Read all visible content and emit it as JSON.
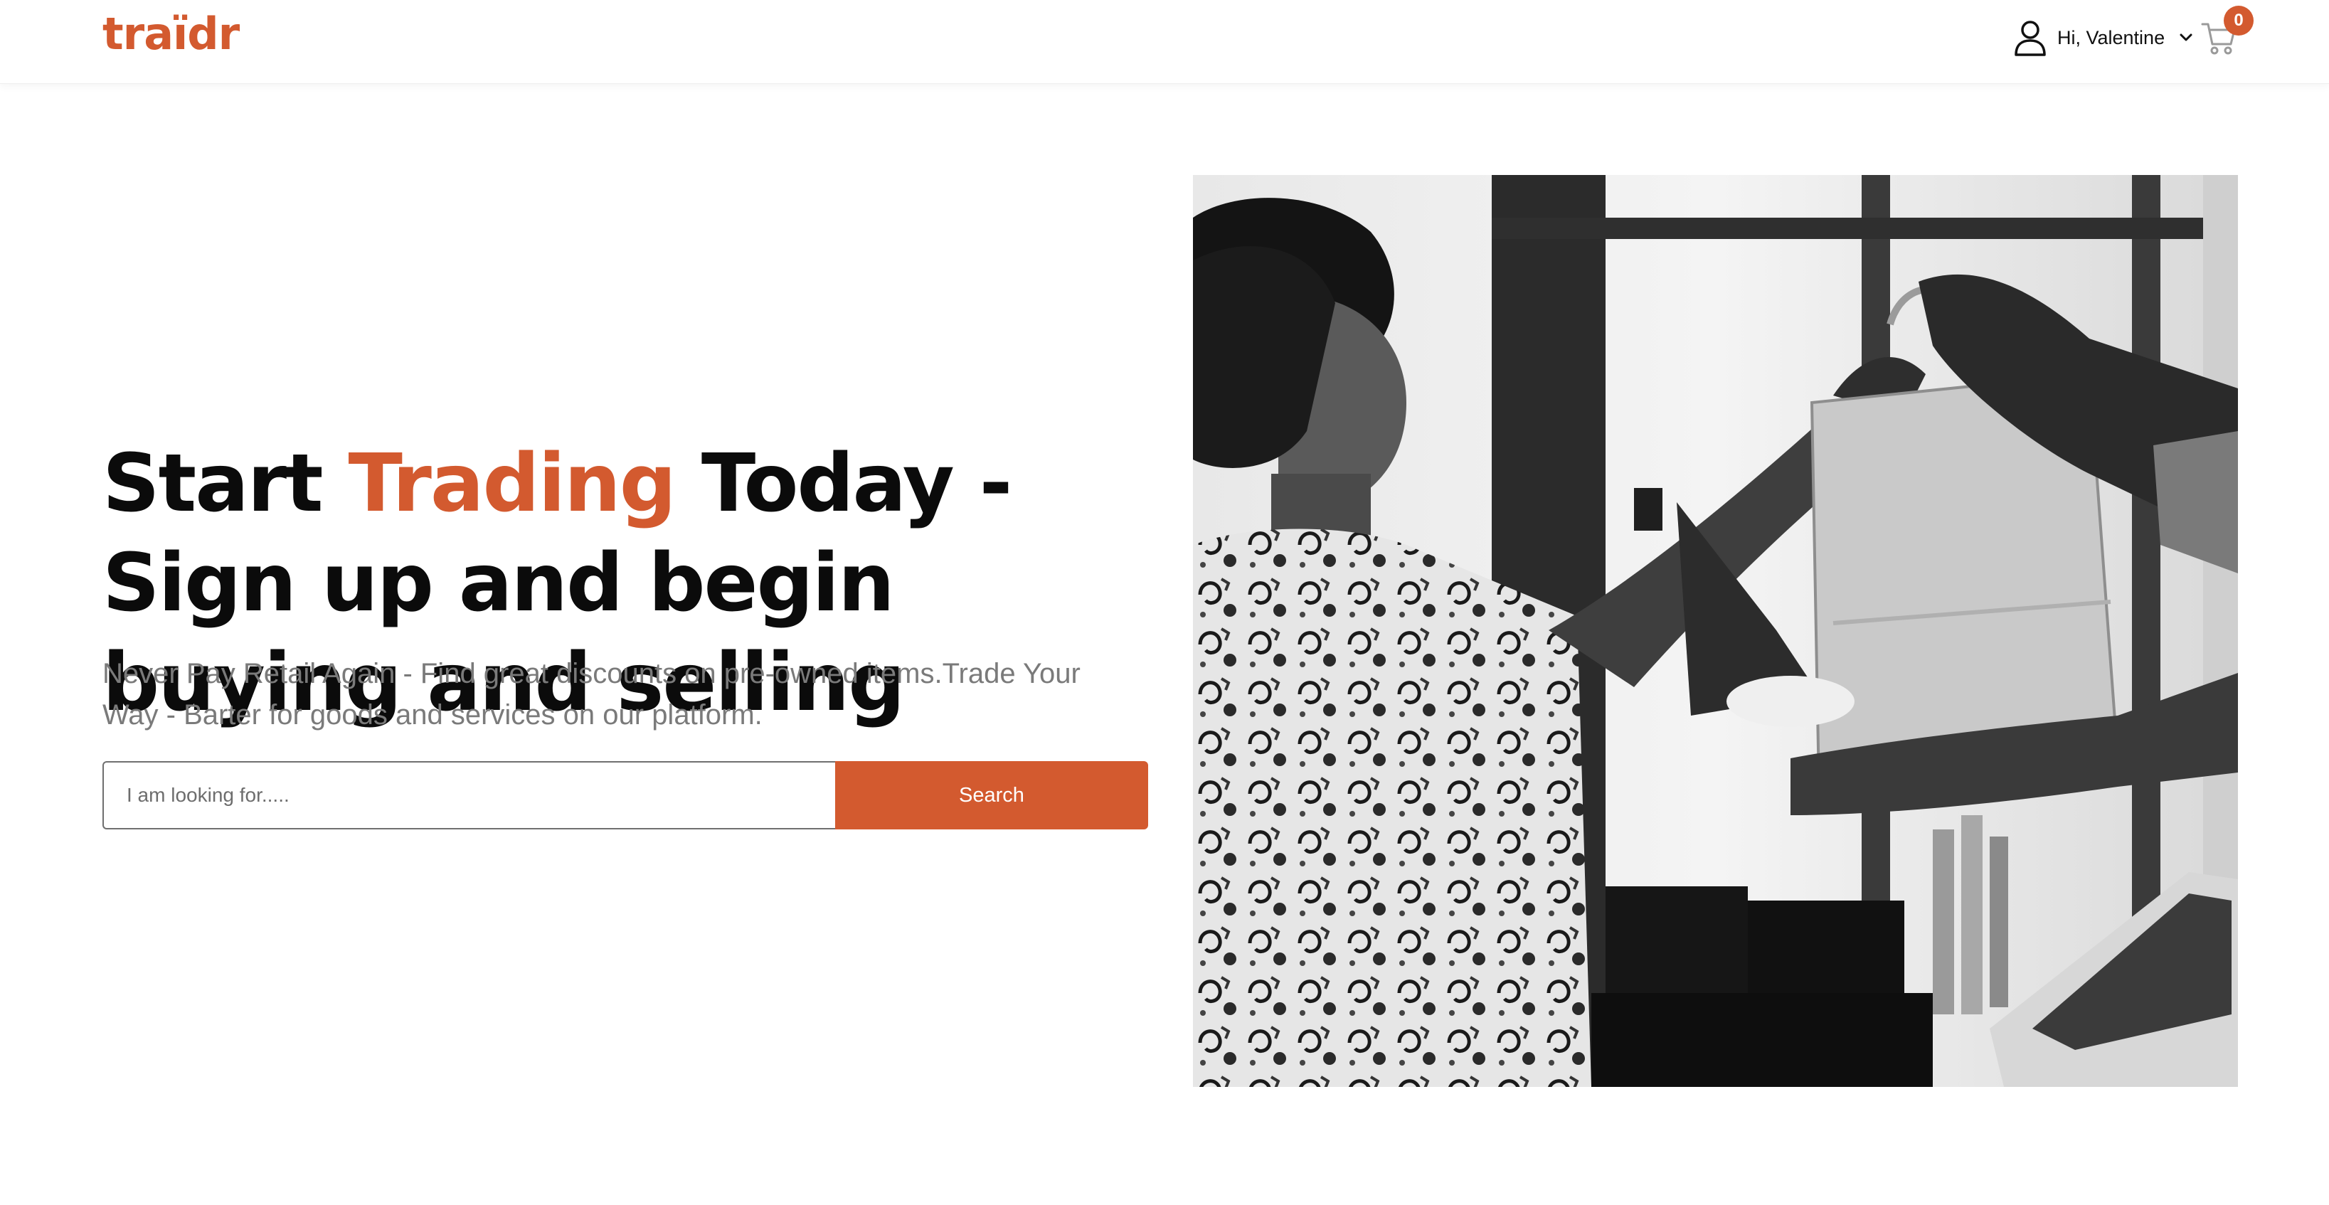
{
  "header": {
    "logo_text": "traïdr",
    "user": {
      "greeting": "Hi, Valentine",
      "icon": "user-icon",
      "menu_icon": "chevron-down-icon"
    },
    "cart": {
      "icon": "cart-icon",
      "count": "0"
    }
  },
  "hero": {
    "title_start": "Start ",
    "title_accent": "Trading",
    "title_end": " Today - Sign up and begin buying and selling",
    "subtitle": "Never Pay Retail Again - Find great discounts on pre-owned items.Trade Your Way - Barter for goods and services on our platform.",
    "search": {
      "placeholder": "I am looking for.....",
      "value": "",
      "button_label": "Search"
    }
  },
  "colors": {
    "brand": "#d35a2f",
    "text": "#0b0b0b",
    "muted": "#7a7a7a"
  }
}
